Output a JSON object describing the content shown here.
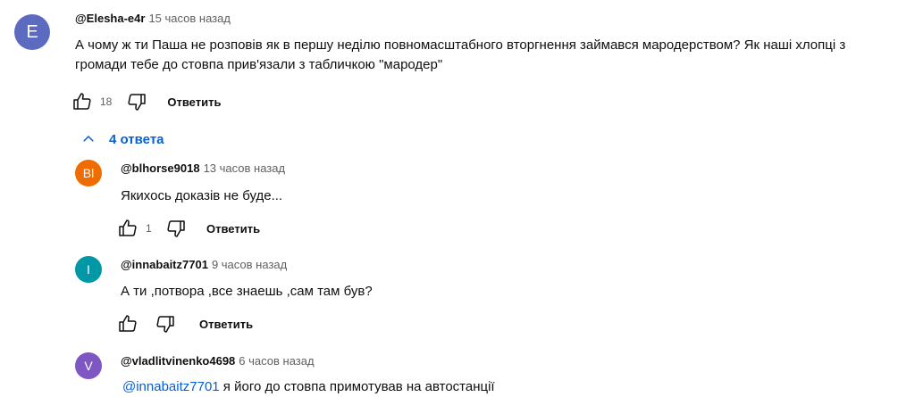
{
  "comment": {
    "avatar_letter": "E",
    "avatar_color": "#5c6bc0",
    "author": "@Elesha-e4r",
    "time": "15 часов назад",
    "text": "А чому ж ти Паша не розповів як в першу неділю повномасштабного вторгнення займався мародерством? Як наші хлопці з громади тебе до стовпа прив'язали з табличкою \"мародер\"",
    "likes": "18",
    "reply_label": "Ответить"
  },
  "replies_toggle": {
    "label": "4 ответа",
    "icon": "chevron-up-icon"
  },
  "replies": [
    {
      "avatar_letter": "Bl",
      "avatar_color": "#ef6c00",
      "author": "@blhorse9018",
      "time": "13 часов назад",
      "text": "Якихось доказів не буде...",
      "likes": "1",
      "reply_label": "Ответить"
    },
    {
      "avatar_letter": "I",
      "avatar_color": "#0097a7",
      "author": "@innabaitz7701",
      "time": "9 часов назад",
      "text": "А ти ,потвора ,все знаешь ,сам там був?",
      "likes": "",
      "reply_label": "Ответить"
    },
    {
      "avatar_letter": "V",
      "avatar_color": "#7e57c2",
      "author": "@vladlitvinenko4698",
      "time": "6 часов назад",
      "mention": "@innabaitz7701",
      "text": " я його до стовпа примотував на автостанції"
    }
  ]
}
